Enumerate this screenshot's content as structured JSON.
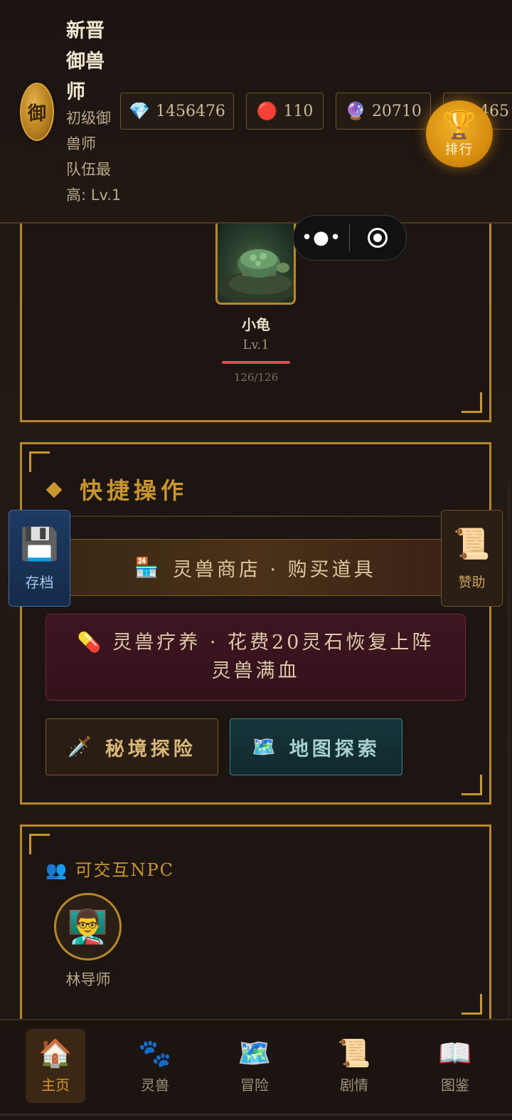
{
  "header": {
    "avatar_char": "御",
    "player_name": "新晋御兽师",
    "player_title": "初级御兽师",
    "team_info": "队伍最高: Lv.1",
    "resources": [
      {
        "icon": "gem-icon",
        "glyph": "💎",
        "value": "1456476"
      },
      {
        "icon": "red-orb-icon",
        "glyph": "🔴",
        "value": "110"
      },
      {
        "icon": "crystal-ball-icon",
        "glyph": "🔮",
        "value": "20710"
      },
      {
        "icon": "resource-icon",
        "glyph": "",
        "value": "465"
      }
    ],
    "rank_label": "排行"
  },
  "capsule": {
    "more": "•●•"
  },
  "pet": {
    "name": "小龟",
    "level": "Lv.1",
    "hp_text": "126/126",
    "hp_fraction": 1.0
  },
  "quick_actions": {
    "title": "快捷操作",
    "shop_label": "灵兽商店 · 购买道具",
    "shop_icon": "🏪",
    "heal_label": "灵兽疗养 · 花费20灵石恢复上阵灵兽满血",
    "heal_icon": "💊",
    "explore_label": "秘境探险",
    "explore_icon": "🗡️",
    "map_label": "地图探索",
    "map_icon": "🗺️"
  },
  "side": {
    "save_label": "存档",
    "save_icon": "💾",
    "sponsor_label": "赞助",
    "sponsor_icon": "📜"
  },
  "npc": {
    "title": "可交互NPC",
    "title_icon": "👥",
    "items": [
      {
        "name": "林导师",
        "glyph": "👨‍🏫"
      }
    ]
  },
  "nav": {
    "items": [
      {
        "label": "主页",
        "glyph": "🏠",
        "active": true
      },
      {
        "label": "灵兽",
        "glyph": "🐾",
        "active": false
      },
      {
        "label": "冒险",
        "glyph": "🗺️",
        "active": false
      },
      {
        "label": "剧情",
        "glyph": "📜",
        "active": false
      },
      {
        "label": "图鉴",
        "glyph": "📖",
        "active": false
      }
    ]
  },
  "colors": {
    "accent_gold": "#b8862b",
    "active_nav": "#d9962a",
    "hp_red": "#d45050"
  }
}
